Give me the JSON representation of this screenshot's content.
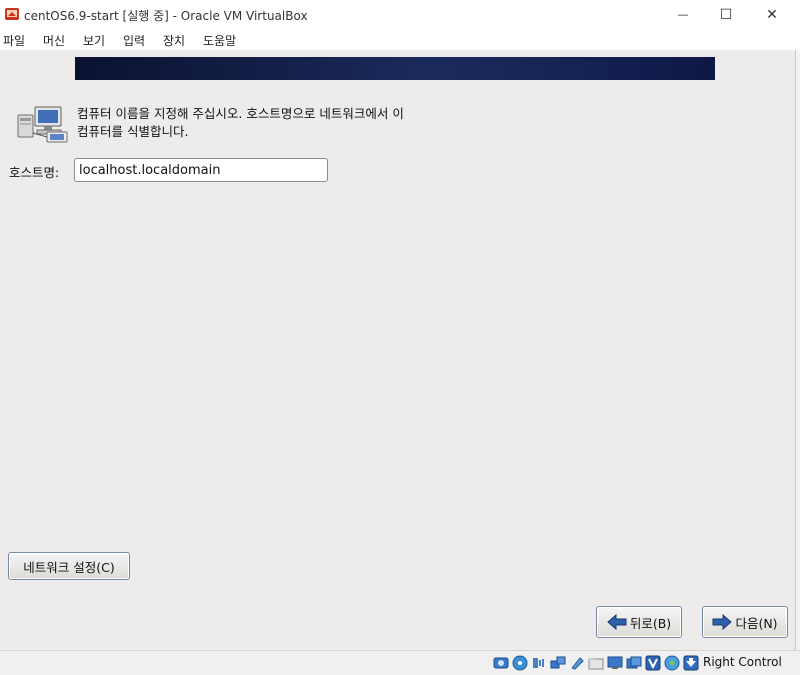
{
  "window": {
    "title": "centOS6.9-start [실행 중] - Oracle VM VirtualBox",
    "minimize_glyph": "—",
    "maximize_glyph": "☐",
    "close_glyph": "✕"
  },
  "menu": {
    "items": [
      "파일",
      "머신",
      "보기",
      "입력",
      "장치",
      "도움말"
    ]
  },
  "installer": {
    "description": "컴퓨터 이름을 지정해 주십시오. 호스트명으로 네트워크에서 이 컴퓨터를 식별합니다.",
    "hostname_label": "호스트명:",
    "hostname_value": "localhost.localdomain",
    "network_button": "네트워크 설정(C)",
    "back_button": "뒤로(B)",
    "next_button": "다음(N)"
  },
  "statusbar": {
    "icons": [
      "hard-disk-icon",
      "optical-drive-icon",
      "audio-icon",
      "network-icon",
      "usb-icon",
      "shared-folder-icon",
      "display-icon",
      "recording-icon",
      "virtualization-icon",
      "mouse-integration-icon",
      "host-key-arrow-icon"
    ],
    "host_key": "Right Control"
  },
  "colors": {
    "vm_background": "#edecea",
    "banner": "#142153",
    "arrow_blue": "#2f5fa8"
  }
}
